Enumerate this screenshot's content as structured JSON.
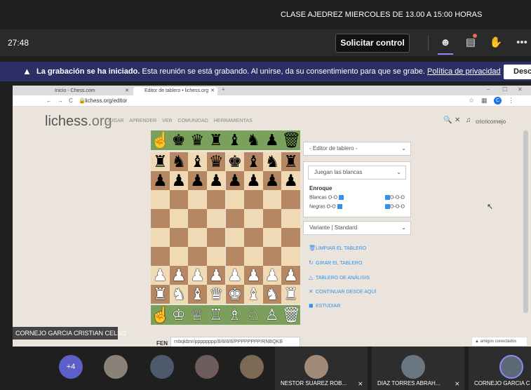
{
  "meeting": {
    "title": "CLASE AJEDREZ MIERCOLES DE 13.00 A 15:00 HORAS",
    "timer": "27:48",
    "request_control": "Solicitar control",
    "icons": [
      "participants-icon",
      "chat-icon",
      "raise-hand-icon",
      "more-icon"
    ]
  },
  "banner": {
    "bold": "La grabación se ha iniciado.",
    "text": " Esta reunión se está grabando. Al unirse, da su consentimiento para que se grabe. ",
    "link": "Política de privacidad",
    "button": "Desc"
  },
  "browser": {
    "tabs": [
      "Inicio - Chess.com",
      "Editor de tablero • lichess.org"
    ],
    "url": "lichess.org/editor",
    "avatar": "C"
  },
  "lichess": {
    "logo": "lichess",
    "logo_tld": ".org",
    "nav": [
      "JUGAR",
      "APRENDER",
      "VER",
      "COMUNIDAD",
      "HERRAMIENTAS"
    ],
    "username": "cricricornejo",
    "editor_select": "- Editor de tablero -",
    "turn_select": "Juegan las blancas",
    "enroque": "Enroque",
    "white_short": "Blancas O-O",
    "black_short": "Negras O-O",
    "white_long": "O-O-O",
    "black_long": "O-O-O",
    "variant": "Variante | Standard",
    "actions": [
      "LIMPIAR EL TABLERO",
      "GIRAR EL TABLERO",
      "TABLERO DE ANÁLISIS",
      "CONTINUAR DESDE AQUÍ",
      "ESTUDIAR"
    ],
    "fen_label": "FEN",
    "fen": "rnbqkbnr/pppppppp/8/8/8/8/PPPPPPPP/RNBQKB",
    "friends": "▲ amigos conectados",
    "board": [
      "rnbqkbnr",
      "pppppppp",
      "........",
      "........",
      "........",
      "........",
      "PPPPPPPP",
      "RNBQKBNR"
    ],
    "spare_top": "☝♚♛♜♝♞♟🗑",
    "spare_bottom": "☝♔♕♖♗♘♙🗑"
  },
  "presenter": "CORNEJO GARCIA CRISTIAN CELSO",
  "participants": {
    "more": "+4",
    "tiles": [
      "NESTOR SUAREZ ROB...",
      "DIAZ TORRES ABRAH...",
      "CORNEJO GARCIA C"
    ]
  }
}
